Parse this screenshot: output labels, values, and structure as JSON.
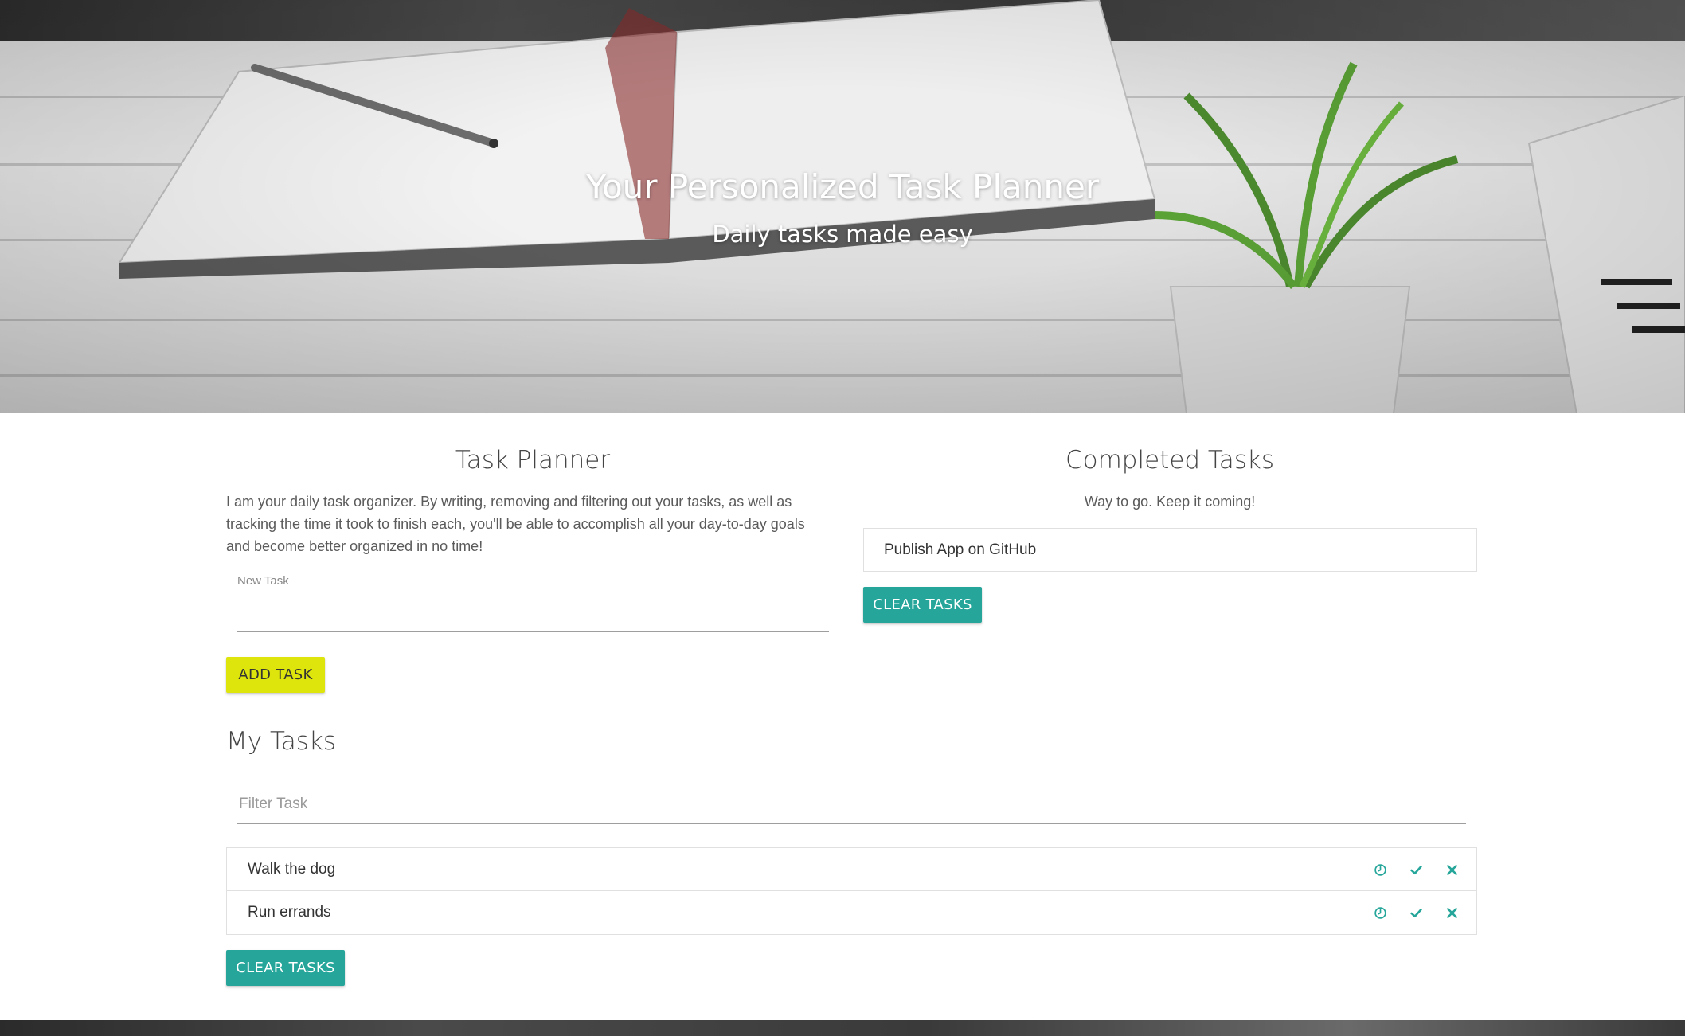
{
  "hero": {
    "title": "Your Personalized Task Planner",
    "subtitle": "Daily tasks made easy"
  },
  "planner": {
    "title": "Task Planner",
    "description": "I am your daily task organizer. By writing, removing and filtering out your tasks, as well as tracking the time it took to finish each, you'll be able to accomplish all your day-to-day goals and become better organized in no time!",
    "new_task_label": "New Task",
    "new_task_value": "",
    "add_button": "ADD TASK"
  },
  "my_tasks": {
    "title": "My Tasks",
    "filter_placeholder": "Filter Task",
    "items": [
      {
        "label": "Walk the dog",
        "icons": [
          "clock-icon",
          "check-icon",
          "close-icon"
        ]
      },
      {
        "label": "Run errands",
        "icons": [
          "clock-icon",
          "check-icon",
          "close-icon"
        ]
      }
    ],
    "clear_button": "CLEAR TASKS"
  },
  "completed": {
    "title": "Completed Tasks",
    "subtitle": "Way to go. Keep it coming!",
    "items": [
      {
        "label": "Publish App on GitHub"
      }
    ],
    "clear_button": "CLEAR TASKS"
  },
  "colors": {
    "accent_teal": "#26a69a",
    "add_button_yellow": "#dde50d",
    "icon_teal": "#26a69a"
  }
}
